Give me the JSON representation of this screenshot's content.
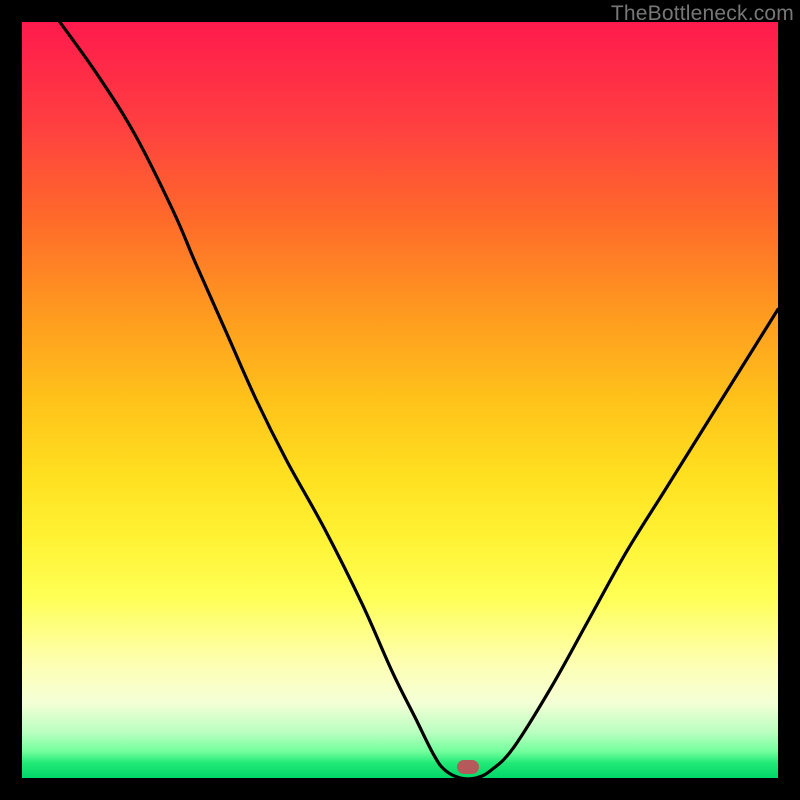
{
  "watermark": "TheBottleneck.com",
  "colors": {
    "frame": "#000000",
    "curve_stroke": "#000000",
    "marker_fill": "#b45a5a"
  },
  "chart_data": {
    "type": "line",
    "title": "",
    "xlabel": "",
    "ylabel": "",
    "xlim": [
      0,
      100
    ],
    "ylim": [
      0,
      100
    ],
    "grid": false,
    "legend": false,
    "series": [
      {
        "name": "bottleneck-curve",
        "x": [
          5,
          10,
          15,
          20,
          23,
          27,
          31,
          35,
          40,
          45,
          49,
          52,
          54.5,
          56,
          58,
          60,
          62,
          65,
          70,
          75,
          80,
          85,
          90,
          95,
          100
        ],
        "y": [
          100,
          93,
          85,
          75,
          68,
          59,
          50,
          42,
          33,
          23,
          14,
          8,
          3,
          1,
          0,
          0,
          1,
          4,
          12,
          21,
          30,
          38,
          46,
          54,
          62
        ]
      }
    ],
    "annotations": [
      {
        "name": "minimum-marker",
        "x": 59,
        "y": 1.5
      }
    ],
    "background_gradient": {
      "orientation": "vertical",
      "stops": [
        {
          "offset": 0.0,
          "color": "#ff1a4d"
        },
        {
          "offset": 0.5,
          "color": "#ffc21a"
        },
        {
          "offset": 0.76,
          "color": "#ffff55"
        },
        {
          "offset": 0.96,
          "color": "#72ff9c"
        },
        {
          "offset": 1.0,
          "color": "#00d867"
        }
      ]
    }
  }
}
